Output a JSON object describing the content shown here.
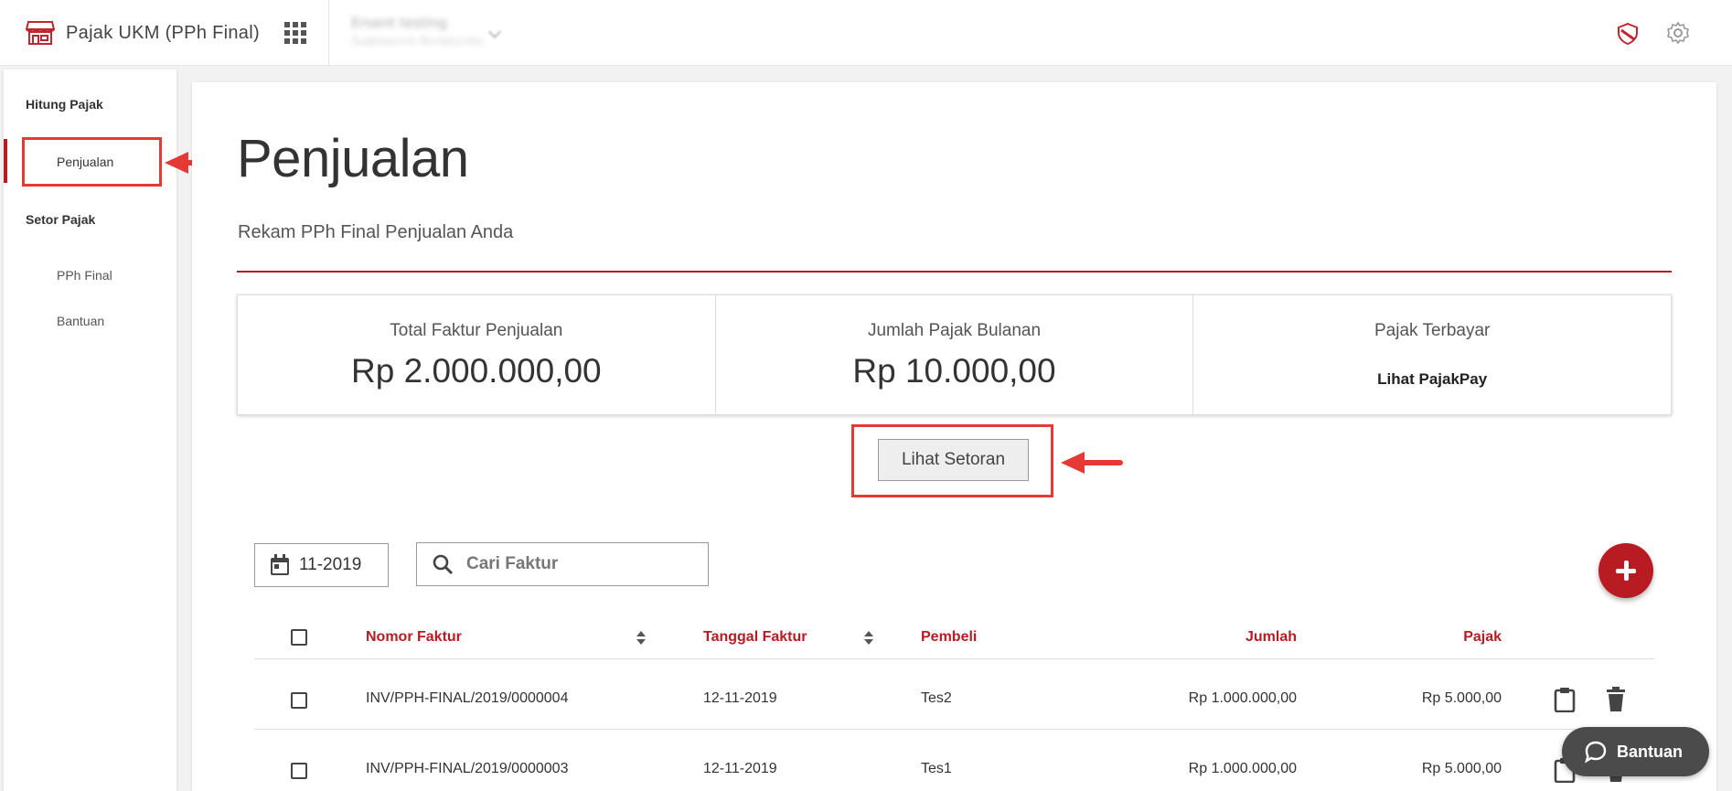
{
  "app": {
    "title": "Pajak UKM (PPh Final)",
    "account_name": "Ersent testing",
    "account_sub": "Suabnecrvh fiicrwtcctes"
  },
  "sidebar": {
    "sections": [
      {
        "heading": "Hitung Pajak",
        "items": [
          {
            "label": "Penjualan",
            "active": true
          }
        ]
      },
      {
        "heading": "Setor Pajak",
        "items": [
          {
            "label": "PPh Final",
            "active": false
          },
          {
            "label": "Bantuan",
            "active": false
          }
        ]
      }
    ]
  },
  "page": {
    "title": "Penjualan",
    "subtitle": "Rekam PPh Final Penjualan Anda"
  },
  "stats": [
    {
      "label": "Total Faktur Penjualan",
      "value": "Rp 2.000.000,00"
    },
    {
      "label": "Jumlah Pajak Bulanan",
      "value": "Rp 10.000,00"
    },
    {
      "label": "Pajak Terbayar",
      "link": "Lihat PajakPay"
    }
  ],
  "actions": {
    "lihat_setoran": "Lihat Setoran"
  },
  "filters": {
    "period": "11-2019",
    "search_placeholder": "Cari Faktur"
  },
  "table": {
    "columns": [
      "Nomor Faktur",
      "Tanggal Faktur",
      "Pembeli",
      "Jumlah",
      "Pajak"
    ],
    "rows": [
      {
        "nomor": "INV/PPH-FINAL/2019/0000004",
        "tanggal": "12-11-2019",
        "pembeli": "Tes2",
        "jumlah": "Rp 1.000.000,00",
        "pajak": "Rp 5.000,00"
      },
      {
        "nomor": "INV/PPH-FINAL/2019/0000003",
        "tanggal": "12-11-2019",
        "pembeli": "Tes1",
        "jumlah": "Rp 1.000.000,00",
        "pajak": "Rp 5.000,00"
      }
    ]
  },
  "help": {
    "label": "Bantuan"
  },
  "colors": {
    "brand_red": "#b81c22",
    "highlight_red": "#e53935",
    "help_bg": "#4b4b4b"
  },
  "icons": [
    "store-icon",
    "apps-grid-icon",
    "shield-icon",
    "gear-icon",
    "calendar-icon",
    "search-icon",
    "add-icon",
    "sort-icon",
    "clipboard-icon",
    "trash-icon",
    "chat-icon",
    "arrow-icon"
  ]
}
